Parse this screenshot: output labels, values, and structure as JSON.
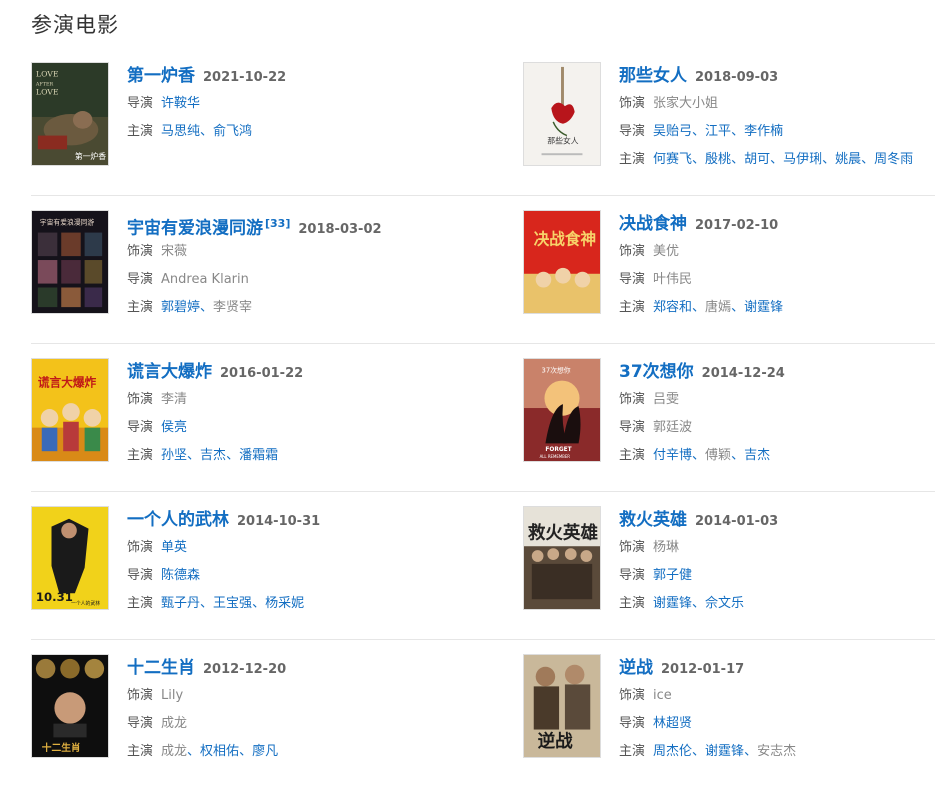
{
  "section": {
    "title": "参演电影"
  },
  "labels": {
    "actor": "饰演",
    "director": "导演",
    "lead": "主演"
  },
  "rows": [
    {
      "left": {
        "title": "第一炉香",
        "ref": "",
        "date": "2021-10-22",
        "role": "",
        "director_plain": "",
        "director_links": [
          "许鞍华"
        ],
        "leads": [
          "马思纯",
          "俞飞鸿"
        ]
      },
      "right": {
        "title": "那些女人",
        "ref": "",
        "date": "2018-09-03",
        "role": "张家大小姐",
        "director_plain": "",
        "director_links": [
          "吴贻弓",
          "江平",
          "李作楠"
        ],
        "leads": [
          "何赛飞",
          "殷桃",
          "胡可",
          "马伊琍",
          "姚晨",
          "周冬雨"
        ]
      }
    },
    {
      "left": {
        "title": "宇宙有爱浪漫同游",
        "ref": "[33]",
        "date": "2018-03-02",
        "role": "宋薇",
        "director_plain": "Andrea Klarin",
        "director_links": [],
        "leads": [
          "郭碧婷",
          "李贤宰"
        ]
      },
      "right": {
        "title": "决战食神",
        "ref": "",
        "date": "2017-02-10",
        "role": "美优",
        "director_plain": "叶伟民",
        "director_links": [],
        "leads": [
          "郑容和",
          "唐嫣",
          "谢霆锋"
        ]
      }
    },
    {
      "left": {
        "title": "谎言大爆炸",
        "ref": "",
        "date": "2016-01-22",
        "role": "李清",
        "director_plain": "",
        "director_links": [
          "侯亮"
        ],
        "leads": [
          "孙坚",
          "吉杰",
          "潘霜霜"
        ]
      },
      "right": {
        "title": "37次想你",
        "ref": "",
        "date": "2014-12-24",
        "role": "吕雯",
        "director_plain": "郭廷波",
        "director_links": [],
        "leads": [
          "付辛博",
          "傅颖",
          "吉杰"
        ]
      }
    },
    {
      "left": {
        "title": "一个人的武林",
        "ref": "",
        "date": "2014-10-31",
        "role": "",
        "role_links": [
          "单英"
        ],
        "director_plain": "",
        "director_links": [
          "陈德森"
        ],
        "leads": [
          "甄子丹",
          "王宝强",
          "杨采妮"
        ]
      },
      "right": {
        "title": "救火英雄",
        "ref": "",
        "date": "2014-01-03",
        "role": "杨琳",
        "director_plain": "",
        "director_links": [
          "郭子健"
        ],
        "leads": [
          "谢霆锋",
          "佘文乐"
        ]
      }
    },
    {
      "left": {
        "title": "十二生肖",
        "ref": "",
        "date": "2012-12-20",
        "role": "Lily",
        "director_plain": "成龙",
        "director_links": [],
        "leads": [
          "成龙",
          "权相佑",
          "廖凡"
        ]
      },
      "right": {
        "title": "逆战",
        "ref": "",
        "date": "2012-01-17",
        "role": "ice",
        "director_plain": "",
        "director_links": [
          "林超贤"
        ],
        "leads": [
          "周杰伦",
          "谢霆锋",
          "安志杰"
        ]
      }
    }
  ],
  "posters": {
    "first_incense": {
      "text1": "LOVE",
      "text2": "AFTER",
      "text3": "LOVE",
      "text4": "第一炉香"
    },
    "those_women": {
      "text1": "那些女人"
    },
    "cosmic_love": {
      "text1": "宇宙有爱浪漫同游"
    },
    "cook_up": {
      "text1": "决战食神"
    },
    "lies": {
      "text1": "谎言大爆炸"
    },
    "forget": {
      "text1": "37次想你",
      "text2": "FORGET",
      "text3": "ALL REMEMBER"
    },
    "wulin": {
      "text1": "10.31",
      "text2": "一个人的武林"
    },
    "firestorm": {
      "text1": "救火英雄"
    },
    "zodiac": {
      "text1": "十二生肖"
    },
    "nizhan": {
      "text1": "逆战"
    }
  },
  "colors": {
    "link": "#136ec2",
    "muted": "#888888",
    "divider": "#e6e6e6"
  }
}
